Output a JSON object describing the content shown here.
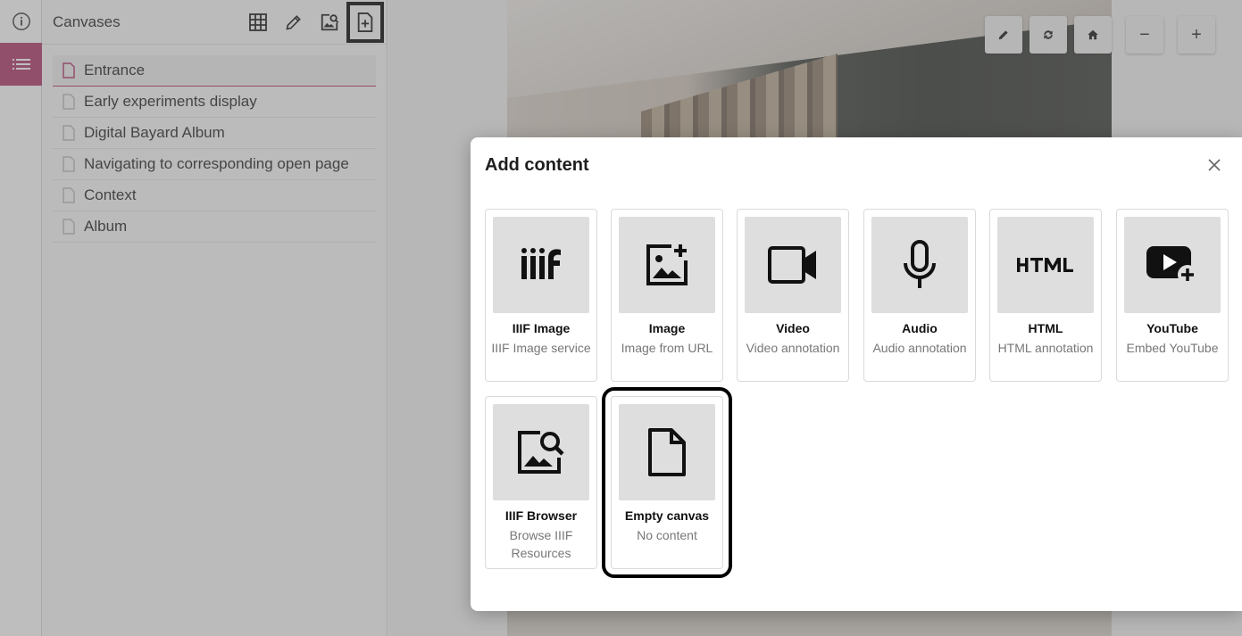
{
  "colors": {
    "accent": "#b0356a",
    "highlight_border": "#000000"
  },
  "rail": [
    {
      "name": "info-icon"
    },
    {
      "name": "list-icon",
      "active": true
    }
  ],
  "panel": {
    "title": "Canvases",
    "tools": [
      "grid-icon",
      "pencil-icon",
      "image-search-icon",
      "add-document-icon"
    ],
    "items": [
      {
        "label": "Entrance",
        "active": true
      },
      {
        "label": "Early experiments display"
      },
      {
        "label": "Digital Bayard Album"
      },
      {
        "label": "Navigating to corresponding open page"
      },
      {
        "label": "Context"
      },
      {
        "label": "Album"
      }
    ]
  },
  "viewer": {
    "controls": [
      "edit-icon",
      "rotate-icon",
      "home-icon",
      "zoom-out-icon",
      "zoom-in-icon"
    ],
    "control_glyphs": {
      "zoom_out": "−",
      "zoom_in": "+"
    }
  },
  "modal": {
    "title": "Add content",
    "options": [
      {
        "icon": "iiif-icon",
        "label": "IIIF Image",
        "desc": "IIIF Image service"
      },
      {
        "icon": "add-image-icon",
        "label": "Image",
        "desc": "Image from URL"
      },
      {
        "icon": "video-icon",
        "label": "Video",
        "desc": "Video annotation"
      },
      {
        "icon": "microphone-icon",
        "label": "Audio",
        "desc": "Audio annotation"
      },
      {
        "icon": "html-icon",
        "label": "HTML",
        "desc": "HTML annotation"
      },
      {
        "icon": "youtube-icon",
        "label": "YouTube",
        "desc": "Embed YouTube"
      },
      {
        "icon": "image-search-icon",
        "label": "IIIF Browser",
        "desc": "Browse IIIF Resources"
      },
      {
        "icon": "blank-document-icon",
        "label": "Empty canvas",
        "desc": "No content",
        "highlighted": true
      }
    ]
  }
}
